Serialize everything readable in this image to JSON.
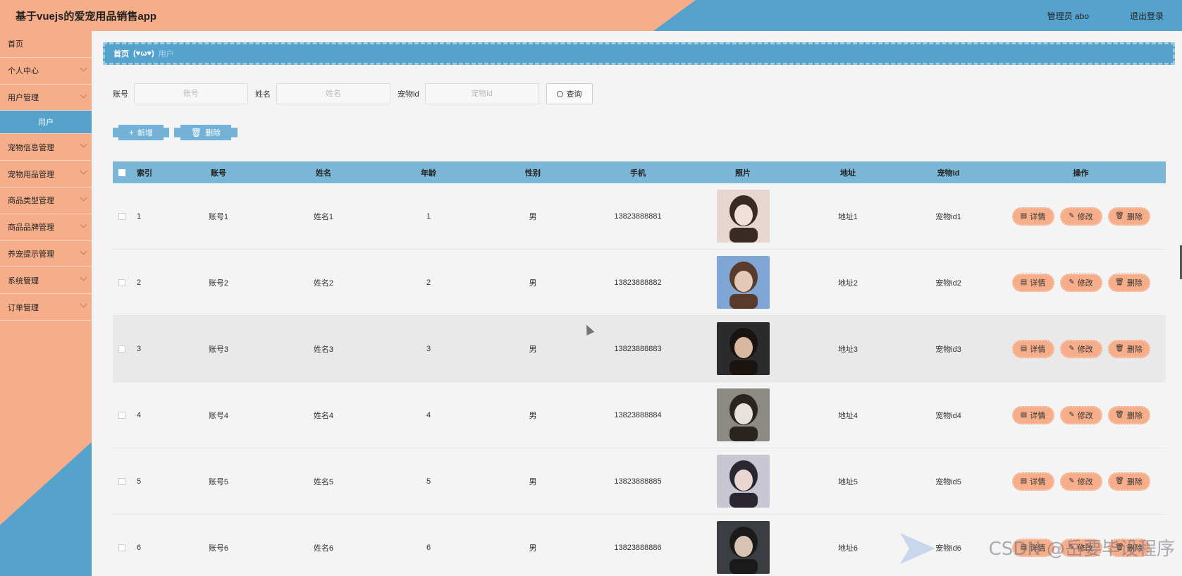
{
  "app": {
    "title": "基于vuejs的爱宠用品销售app",
    "user_label": "管理员 abo",
    "logout_label": "退出登录"
  },
  "sidebar": {
    "items": [
      {
        "label": "首页",
        "chevron": false
      },
      {
        "label": "个人中心",
        "chevron": true
      },
      {
        "label": "用户管理",
        "chevron": true
      },
      {
        "label": "用户",
        "chevron": false,
        "active": true
      },
      {
        "label": "宠物信息管理",
        "chevron": true
      },
      {
        "label": "宠物用品管理",
        "chevron": true
      },
      {
        "label": "商品类型管理",
        "chevron": true
      },
      {
        "label": "商品品牌管理",
        "chevron": true
      },
      {
        "label": "养宠提示管理",
        "chevron": true
      },
      {
        "label": "系统管理",
        "chevron": true
      },
      {
        "label": "订单管理",
        "chevron": true
      }
    ]
  },
  "breadcrumb": {
    "home": "首页",
    "separator": "(♥ω♥)",
    "current": "用户"
  },
  "search": {
    "account_label": "账号",
    "account_placeholder": "账号",
    "name_label": "姓名",
    "name_placeholder": "姓名",
    "pet_label": "宠物id",
    "pet_placeholder": "宠物id",
    "query_label": "查询"
  },
  "actions": {
    "add_label": "新增",
    "delete_label": "删除"
  },
  "table": {
    "headers": [
      "索引",
      "账号",
      "姓名",
      "年龄",
      "性别",
      "手机",
      "照片",
      "地址",
      "宠物id",
      "操作"
    ],
    "op_labels": {
      "detail": "详情",
      "edit": "修改",
      "remove": "删除"
    },
    "rows": [
      {
        "index": "1",
        "account": "账号1",
        "name": "姓名1",
        "age": "1",
        "gender": "男",
        "phone": "13823888881",
        "address": "地址1",
        "pet_id": "宠物id1"
      },
      {
        "index": "2",
        "account": "账号2",
        "name": "姓名2",
        "age": "2",
        "gender": "男",
        "phone": "13823888882",
        "address": "地址2",
        "pet_id": "宠物id2"
      },
      {
        "index": "3",
        "account": "账号3",
        "name": "姓名3",
        "age": "3",
        "gender": "男",
        "phone": "13823888883",
        "address": "地址3",
        "pet_id": "宠物id3"
      },
      {
        "index": "4",
        "account": "账号4",
        "name": "姓名4",
        "age": "4",
        "gender": "男",
        "phone": "13823888884",
        "address": "地址4",
        "pet_id": "宠物id4"
      },
      {
        "index": "5",
        "account": "账号5",
        "name": "姓名5",
        "age": "5",
        "gender": "男",
        "phone": "13823888885",
        "address": "地址5",
        "pet_id": "宠物id5"
      },
      {
        "index": "6",
        "account": "账号6",
        "name": "姓名6",
        "age": "6",
        "gender": "男",
        "phone": "13823888886",
        "address": "地址6",
        "pet_id": "宠物id6"
      }
    ]
  },
  "watermark": "CSDN @岳要毕设程序",
  "colors": {
    "accent_orange": "#f5ad8a",
    "accent_blue": "#55a2cc",
    "table_header": "#7bb6d6"
  }
}
